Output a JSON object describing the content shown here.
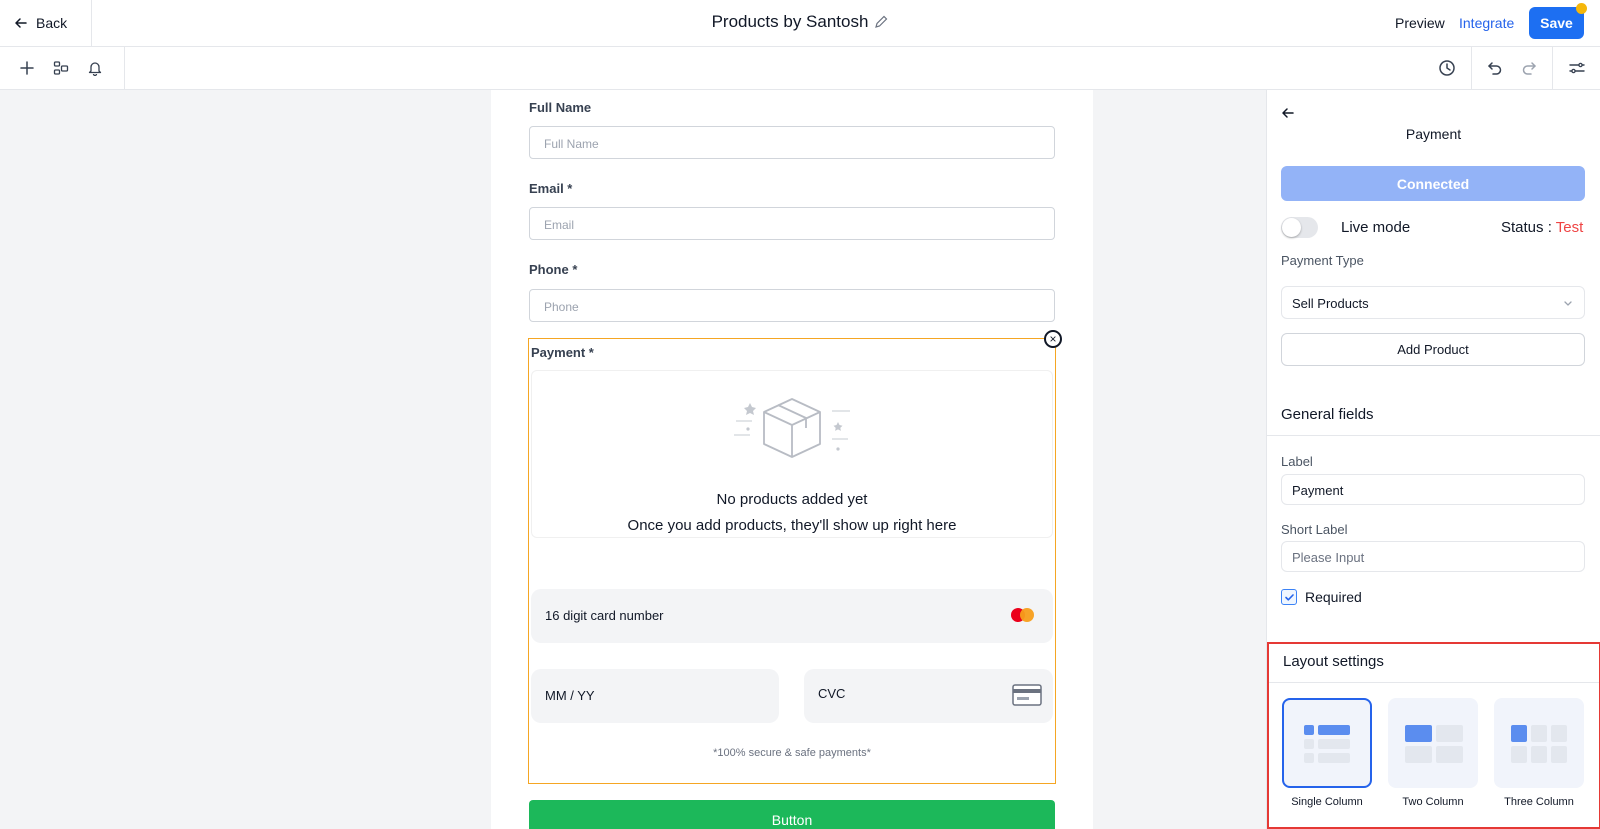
{
  "header": {
    "back_label": "Back",
    "title": "Products by Santosh",
    "preview_label": "Preview",
    "integrate_label": "Integrate",
    "save_label": "Save"
  },
  "toolbar": {
    "left_icons": [
      "plus-icon",
      "layers-icon",
      "bell-icon"
    ],
    "right_icons": [
      "history-icon",
      "undo-icon",
      "redo-icon",
      "sliders-icon"
    ]
  },
  "form": {
    "full_name": {
      "label": "Full Name",
      "placeholder": "Full Name"
    },
    "email": {
      "label": "Email *",
      "placeholder": "Email"
    },
    "phone": {
      "label": "Phone *",
      "placeholder": "Phone"
    },
    "payment": {
      "label": "Payment *",
      "empty_title": "No products added yet",
      "empty_subtitle": "Once you add products, they'll show up right here",
      "card_number_placeholder": "16 digit card number",
      "expiry_placeholder": "MM / YY",
      "cvc_placeholder": "CVC",
      "secure_note": "*100% secure & safe payments*"
    },
    "submit_label": "Button"
  },
  "panel": {
    "title": "Payment",
    "connected_label": "Connected",
    "live_mode_label": "Live mode",
    "live_mode_on": false,
    "status_prefix": "Status : ",
    "status_value": "Test",
    "payment_type_label": "Payment Type",
    "payment_type_value": "Sell Products",
    "add_product_label": "Add Product",
    "general_fields_heading": "General fields",
    "label_label": "Label",
    "label_value": "Payment",
    "short_label_label": "Short Label",
    "short_label_placeholder": "Please Input",
    "required_label": "Required",
    "required_checked": true,
    "layout_heading": "Layout settings",
    "layout_options": [
      {
        "label": "Single Column",
        "selected": true
      },
      {
        "label": "Two Column",
        "selected": false
      },
      {
        "label": "Three Column",
        "selected": false
      }
    ]
  },
  "colors": {
    "primary": "#1d6ff2",
    "connected": "#93b3f7",
    "submit": "#1cb85a",
    "payment_outline": "#f5a623",
    "status_test": "#ef4444",
    "highlight": "#e53935"
  }
}
